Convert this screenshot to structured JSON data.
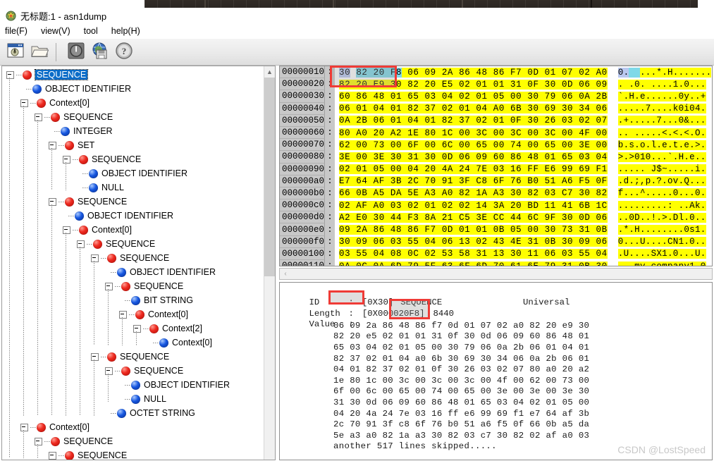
{
  "window": {
    "title": "无标题:1 - asn1dump",
    "app_icon": "app-icon"
  },
  "menu": {
    "items": [
      {
        "label": "file(F)"
      },
      {
        "label": "view(V)"
      },
      {
        "label": "tool"
      },
      {
        "label": "help(H)"
      }
    ]
  },
  "toolbar": {
    "buttons": [
      {
        "name": "new-window-icon",
        "label": ""
      },
      {
        "name": "open-folder-icon",
        "label": ""
      },
      {
        "name": "power-exit-icon",
        "label": ""
      },
      {
        "name": "globe-save-icon",
        "label": ""
      },
      {
        "name": "help-question-icon",
        "label": ""
      }
    ]
  },
  "tree": {
    "nodes": [
      {
        "depth": 0,
        "label": "SEQUENCE",
        "color": "red",
        "expander": true,
        "selected": true
      },
      {
        "depth": 1,
        "label": "OBJECT IDENTIFIER",
        "color": "blue",
        "expander": false,
        "selected": false
      },
      {
        "depth": 1,
        "label": "Context[0]",
        "color": "red",
        "expander": true,
        "selected": false
      },
      {
        "depth": 2,
        "label": "SEQUENCE",
        "color": "red",
        "expander": true,
        "selected": false
      },
      {
        "depth": 3,
        "label": "INTEGER",
        "color": "blue",
        "expander": false,
        "selected": false
      },
      {
        "depth": 3,
        "label": "SET",
        "color": "red",
        "expander": true,
        "selected": false
      },
      {
        "depth": 4,
        "label": "SEQUENCE",
        "color": "red",
        "expander": true,
        "selected": false
      },
      {
        "depth": 5,
        "label": "OBJECT IDENTIFIER",
        "color": "blue",
        "expander": false,
        "selected": false
      },
      {
        "depth": 5,
        "label": "NULL",
        "color": "blue",
        "expander": false,
        "selected": false
      },
      {
        "depth": 3,
        "label": "SEQUENCE",
        "color": "red",
        "expander": true,
        "selected": false
      },
      {
        "depth": 4,
        "label": "OBJECT IDENTIFIER",
        "color": "blue",
        "expander": false,
        "selected": false
      },
      {
        "depth": 4,
        "label": "Context[0]",
        "color": "red",
        "expander": true,
        "selected": false
      },
      {
        "depth": 5,
        "label": "SEQUENCE",
        "color": "red",
        "expander": true,
        "selected": false
      },
      {
        "depth": 6,
        "label": "SEQUENCE",
        "color": "red",
        "expander": true,
        "selected": false
      },
      {
        "depth": 7,
        "label": "OBJECT IDENTIFIER",
        "color": "blue",
        "expander": false,
        "selected": false
      },
      {
        "depth": 7,
        "label": "SEQUENCE",
        "color": "red",
        "expander": true,
        "selected": false
      },
      {
        "depth": 8,
        "label": "BIT STRING",
        "color": "blue",
        "expander": false,
        "selected": false
      },
      {
        "depth": 8,
        "label": "Context[0]",
        "color": "red",
        "expander": true,
        "selected": false
      },
      {
        "depth": 9,
        "label": "Context[2]",
        "color": "red",
        "expander": true,
        "selected": false
      },
      {
        "depth": 10,
        "label": "Context[0]",
        "color": "blue",
        "expander": false,
        "selected": false
      },
      {
        "depth": 6,
        "label": "SEQUENCE",
        "color": "red",
        "expander": true,
        "selected": false
      },
      {
        "depth": 7,
        "label": "SEQUENCE",
        "color": "red",
        "expander": true,
        "selected": false
      },
      {
        "depth": 8,
        "label": "OBJECT IDENTIFIER",
        "color": "blue",
        "expander": false,
        "selected": false
      },
      {
        "depth": 8,
        "label": "NULL",
        "color": "blue",
        "expander": false,
        "selected": false
      },
      {
        "depth": 7,
        "label": "OCTET STRING",
        "color": "blue",
        "expander": false,
        "selected": false
      },
      {
        "depth": 1,
        "label": "Context[0]",
        "color": "red",
        "expander": true,
        "selected": false
      },
      {
        "depth": 2,
        "label": "SEQUENCE",
        "color": "red",
        "expander": true,
        "selected": false
      },
      {
        "depth": 3,
        "label": "SEQUENCE",
        "color": "red",
        "expander": true,
        "selected": false
      }
    ]
  },
  "hex_view": {
    "rows": [
      {
        "offset": "00000010",
        "bytes": "30 82 20 F8 06 09 2A 86 48 86 F7 0D 01 07 02 A0",
        "ascii": "0.  ...*.H......."
      },
      {
        "offset": "00000020",
        "bytes": "82 20 E9 30 82 20 E5 02 01 01 31 0F 30 0D 06 09",
        "ascii": ". .0. ....1.0..."
      },
      {
        "offset": "00000030",
        "bytes": "60 86 48 01 65 03 04 02 01 05 00 30 79 06 0A 2B",
        "ascii": "`.H.e......0y..+"
      },
      {
        "offset": "00000040",
        "bytes": "06 01 04 01 82 37 02 01 04 A0 6B 30 69 30 34 06",
        "ascii": ".....7....k0i04."
      },
      {
        "offset": "00000050",
        "bytes": "0A 2B 06 01 04 01 82 37 02 01 0F 30 26 03 02 07",
        "ascii": ".+.....7...0&..."
      },
      {
        "offset": "00000060",
        "bytes": "80 A0 20 A2 1E 80 1C 00 3C 00 3C 00 3C 00 4F 00",
        "ascii": ".. .....<.<.<.O."
      },
      {
        "offset": "00000070",
        "bytes": "62 00 73 00 6F 00 6C 00 65 00 74 00 65 00 3E 00",
        "ascii": "b.s.o.l.e.t.e.>."
      },
      {
        "offset": "00000080",
        "bytes": "3E 00 3E 30 31 30 0D 06 09 60 86 48 01 65 03 04",
        "ascii": ">.>010...`.H.e.."
      },
      {
        "offset": "00000090",
        "bytes": "02 01 05 00 04 20 4A 24 7E 03 16 FF E6 99 69 F1",
        "ascii": "..... J$~.....i."
      },
      {
        "offset": "000000a0",
        "bytes": "E7 64 AF 3B 2C 70 91 3F C8 6F 76 B0 51 A6 F5 0F",
        "ascii": ".d.;,p.?.ov.Q..."
      },
      {
        "offset": "000000b0",
        "bytes": "66 0B A5 DA 5E A3 A0 82 1A A3 30 82 03 C7 30 82",
        "ascii": "f...^.....0...0."
      },
      {
        "offset": "000000c0",
        "bytes": "02 AF A0 03 02 01 02 02 14 3A 20 BD 11 41 6B 1C",
        "ascii": ".........: ..Ak."
      },
      {
        "offset": "000000d0",
        "bytes": "A2 E0 30 44 F3 8A 21 C5 3E CC 44 6C 9F 30 0D 06",
        "ascii": "..0D..!.>.Dl.0.."
      },
      {
        "offset": "000000e0",
        "bytes": "09 2A 86 48 86 F7 0D 01 01 0B 05 00 30 73 31 0B",
        "ascii": ".*.H........0s1."
      },
      {
        "offset": "000000f0",
        "bytes": "30 09 06 03 55 04 06 13 02 43 4E 31 0B 30 09 06",
        "ascii": "0...U....CN1.0.."
      },
      {
        "offset": "00000100",
        "bytes": "03 55 04 08 0C 02 53 58 31 13 30 11 06 03 55 04",
        "ascii": ".U....SX1.0...U."
      },
      {
        "offset": "00000110",
        "bytes": "0A 0C 0A 6D 79 5F 63 6F 6D 70 61 6E 79 31 0B 30",
        "ascii": "...my_company1.0"
      }
    ],
    "selection": {
      "lavender_bytes": "30",
      "cyan_bytes": "82 20 F8",
      "lavender_ascii": "0.",
      "cyan_ascii": "  "
    },
    "hscroll_left_arrow": "‹"
  },
  "detail": {
    "id_label": "ID",
    "id_colon": ":",
    "id_value": "[0X30]",
    "id_name": "SEQUENCE",
    "id_class": "Universal",
    "length_label": "Length",
    "length_colon": ":",
    "length_hex": "[0X000020F8]",
    "length_dec": "8440",
    "value_label": "Value",
    "value_colon": ":",
    "value_lines": [
      "06 09 2a 86 48 86 f7 0d 01 07 02 a0 82 20 e9 30",
      "82 20 e5 02 01 01 31 0f 30 0d 06 09 60 86 48 01",
      "65 03 04 02 01 05 00 30 79 06 0a 2b 06 01 04 01",
      "82 37 02 01 04 a0 6b 30 69 30 34 06 0a 2b 06 01",
      "04 01 82 37 02 01 0f 30 26 03 02 07 80 a0 20 a2",
      "1e 80 1c 00 3c 00 3c 00 3c 00 4f 00 62 00 73 00",
      "6f 00 6c 00 65 00 74 00 65 00 3e 00 3e 00 3e 30",
      "31 30 0d 06 09 60 86 48 01 65 03 04 02 01 05 00",
      "04 20 4a 24 7e 03 16 ff e6 99 69 f1 e7 64 af 3b",
      "2c 70 91 3f c8 6f 76 b0 51 a6 f5 0f 66 0b a5 da",
      "5e a3 a0 82 1a a3 30 82 03 c7 30 82 02 af a0 03",
      "another 517 lines skipped....."
    ]
  },
  "annotations": {
    "box_color": "#ef3b36",
    "boxes": [
      {
        "name": "hex-selection-highlight-box"
      },
      {
        "name": "id-value-highlight-box"
      },
      {
        "name": "length-decimal-highlight-box"
      }
    ]
  },
  "watermark": {
    "text": "CSDN @LostSpeed"
  }
}
